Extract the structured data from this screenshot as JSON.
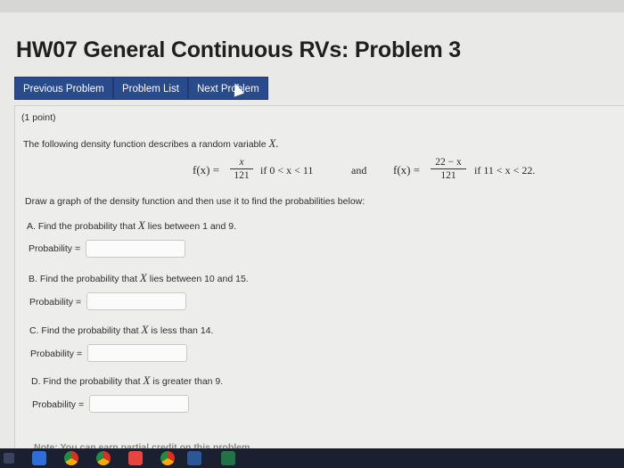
{
  "page_title": "HW07 General Continuous RVs: Problem 3",
  "nav": {
    "previous": "Previous Problem",
    "list": "Problem List",
    "next": "Next Problem"
  },
  "problem": {
    "points": "(1 point)",
    "intro_prefix": "The following density function describes a random variable",
    "intro_var": "X.",
    "f1_lhs": "f(x) =",
    "f1_num": "x",
    "f1_den": "121",
    "f1_cond": "if  0 < x < 11",
    "and": "and",
    "f2_lhs": "f(x) =",
    "f2_num": "22 − x",
    "f2_den": "121",
    "f2_cond": "if  11 < x < 22.",
    "instructions": "Draw a graph of the density function and then use it to find the probabilities below:",
    "parts": [
      {
        "pre": "A. Find the probability that",
        "var": "X",
        "post": "lies between 1 and 9.",
        "label": "Probability =",
        "value": ""
      },
      {
        "pre": "B. Find the probability that",
        "var": "X",
        "post": "lies between 10 and 15.",
        "label": "Probability =",
        "value": ""
      },
      {
        "pre": "C. Find the probability that",
        "var": "X",
        "post": "is less than 14.",
        "label": "Probability =",
        "value": ""
      },
      {
        "pre": "D. Find the probability that",
        "var": "X",
        "post": "is greater than 9.",
        "label": "Probability =",
        "value": ""
      }
    ],
    "note": "Note: You can earn partial credit on this problem."
  },
  "taskbar": {
    "icons": [
      "start-icon",
      "chrome-icon-1",
      "chrome-icon-2",
      "chrome-icon-3",
      "chart-app-icon",
      "chrome-icon-4",
      "word-icon",
      "excel-icon"
    ]
  },
  "colors": {
    "button": "#2a4b8b",
    "background": "#e9e9e7",
    "taskbar": "#1a2030"
  }
}
